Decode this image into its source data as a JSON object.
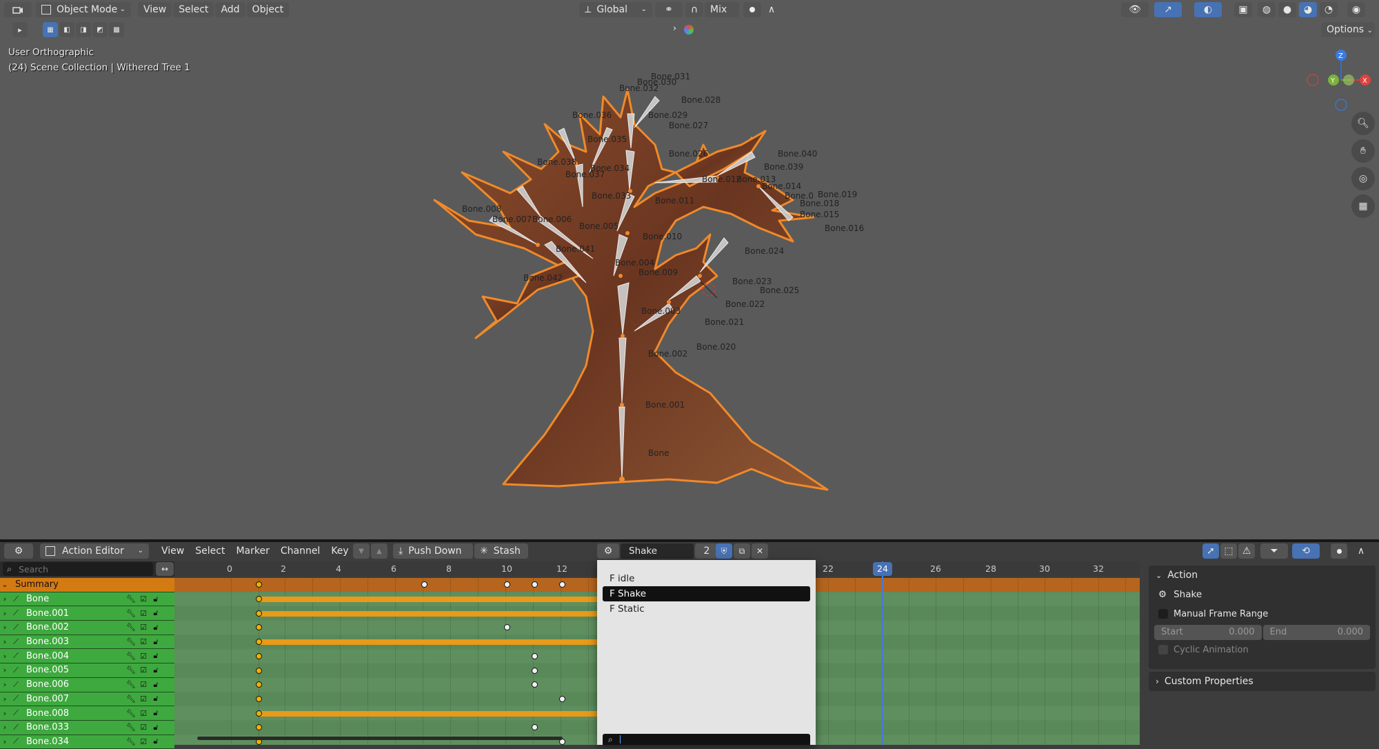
{
  "viewport": {
    "mode_label": "Object Mode",
    "menus": [
      "View",
      "Select",
      "Add",
      "Object"
    ],
    "orientation_label": "Global",
    "proportional_label": "Mix",
    "options_label": "Options",
    "view_name": "User Orthographic",
    "collection_info": "(24) Scene Collection | Withered Tree 1",
    "gizmo": {
      "z": "Z",
      "y": "Y",
      "x": "X"
    },
    "bones": [
      "Bone.031",
      "Bone.030",
      "Bone.032",
      "Bone.028",
      "Bone.036",
      "Bone.029",
      "Bone.027",
      "Bone.035",
      "Bone.026",
      "Bone.040",
      "Bone.038",
      "Bone.034",
      "Bone.039",
      "Bone.037",
      "Bone.012",
      "Bone.013",
      "Bone.014",
      "Bone.0",
      "Bone.019",
      "Bone.033",
      "Bone.011",
      "Bone.018",
      "Bone.008",
      "Bone.015",
      "Bone.007",
      "Bone.006",
      "Bone.005",
      "Bone.016",
      "Bone.010",
      "Bone.041",
      "Bone.024",
      "Bone.004",
      "Bone.042",
      "Bone.009",
      "Bone.023",
      "Bone.025",
      "Bone.022",
      "Bone.003",
      "Bone.021",
      "Bone.002",
      "Bone.020",
      "Bone.001",
      "Bone"
    ]
  },
  "action_editor": {
    "editor_label": "Action Editor",
    "menus": [
      "View",
      "Select",
      "Marker",
      "Channel",
      "Key"
    ],
    "push_down_label": "Push Down",
    "stash_label": "Stash",
    "action_name": "Shake",
    "users_count": "2",
    "search_placeholder": "Search",
    "frame_labels_left": [
      "0",
      "2",
      "4",
      "6",
      "8",
      "10",
      "12"
    ],
    "frame_labels_right": [
      "22",
      "24",
      "26",
      "28",
      "30",
      "32"
    ],
    "current_frame": "24",
    "summary_label": "Summary",
    "channels": [
      "Bone",
      "Bone.001",
      "Bone.002",
      "Bone.003",
      "Bone.004",
      "Bone.005",
      "Bone.006",
      "Bone.007",
      "Bone.008",
      "Bone.033",
      "Bone.034"
    ]
  },
  "action_dropdown": {
    "items": [
      "F idle",
      "F Shake",
      "F Static"
    ],
    "highlighted": "F Shake"
  },
  "sidebar": {
    "action_header": "Action",
    "action_name": "Shake",
    "manual_frame_range_label": "Manual Frame Range",
    "start_label": "Start",
    "start_value": "0.000",
    "end_label": "End",
    "end_value": "0.000",
    "cyclic_label": "Cyclic Animation",
    "custom_properties_label": "Custom Properties"
  },
  "colors": {
    "viewport_bg": "#5a5a5a",
    "channel_green": "#3ea93e",
    "summary_orange": "#d47a12",
    "keyframe_selected": "#f0b000",
    "accent_blue": "#4772b3"
  }
}
